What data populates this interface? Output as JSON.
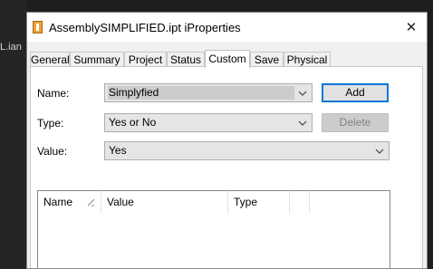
{
  "background": {
    "editor_text": "L.ian"
  },
  "window": {
    "title": "AssemblySIMPLIFIED.ipt iProperties",
    "close_glyph": "✕"
  },
  "tabs": [
    {
      "label": "General"
    },
    {
      "label": "Summary"
    },
    {
      "label": "Project"
    },
    {
      "label": "Status"
    },
    {
      "label": "Custom",
      "active": true
    },
    {
      "label": "Save"
    },
    {
      "label": "Physical"
    }
  ],
  "form": {
    "name_label": "Name:",
    "name_value": "Simplyfied",
    "type_label": "Type:",
    "type_value": "Yes or No",
    "value_label": "Value:",
    "value_value": "Yes"
  },
  "buttons": {
    "add": "Add",
    "delete": "Delete"
  },
  "table": {
    "columns": [
      "Name",
      "Value",
      "Type",
      ""
    ],
    "rows": []
  },
  "colors": {
    "focus_border": "#0078d7",
    "selection": "#cccccc",
    "accent_icon": "#e8a33d"
  }
}
